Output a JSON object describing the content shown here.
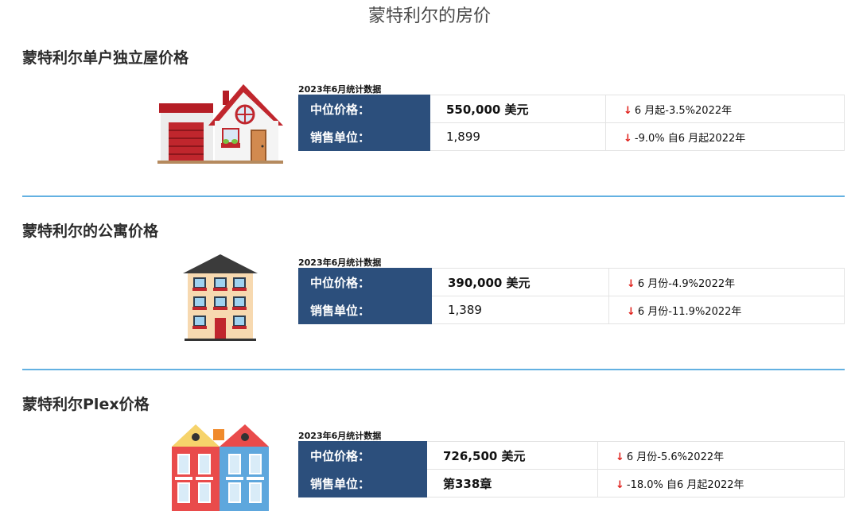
{
  "page_title": "蒙特利尔的房价",
  "sections": [
    {
      "title": "蒙特利尔单户独立屋价格",
      "caption": "2023年6月统计数据",
      "rows": [
        {
          "label": "中位价格：",
          "value": "550,000 美元",
          "change": "6 月起-3.5%2022年"
        },
        {
          "label": "销售单位：",
          "value": "1,899",
          "change": "-9.0% 自6 月起2022年"
        }
      ]
    },
    {
      "title": "蒙特利尔的公寓价格",
      "caption": "2023年6月统计数据",
      "rows": [
        {
          "label": "中位价格：",
          "value": "390,000 美元",
          "change": "6 月份-4.9%2022年"
        },
        {
          "label": "销售单位：",
          "value": "1,389",
          "change": "6 月份-11.9%2022年"
        }
      ]
    },
    {
      "title": "蒙特利尔Plex价格",
      "caption": "2023年6月统计数据",
      "rows": [
        {
          "label": "中位价格：",
          "value": "726,500 美元",
          "change": "6 月份-5.6%2022年"
        },
        {
          "label": "销售单位：",
          "value": "第338章",
          "change": "-18.0% 自6 月起2022年"
        }
      ]
    }
  ],
  "arrow_glyph": "↓",
  "colors": {
    "label_bg": "#2c4f7c",
    "divider": "#63b1e2",
    "down_arrow": "#e0201b"
  }
}
